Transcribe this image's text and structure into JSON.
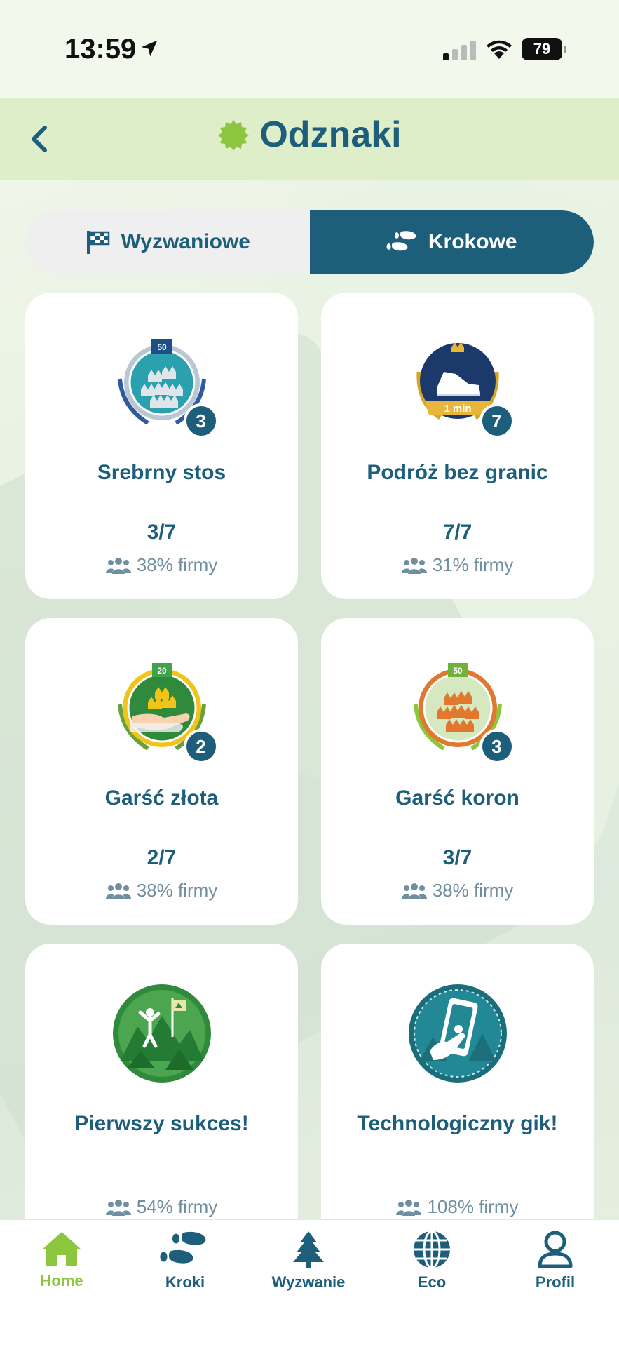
{
  "status": {
    "time": "13:59",
    "battery": "79"
  },
  "header": {
    "title": "Odznaki"
  },
  "segments": {
    "left": "Wyzwaniowe",
    "right": "Krokowe",
    "active": "right"
  },
  "badges": [
    {
      "name": "Srebrny stos",
      "progress": "3/7",
      "percent": "38% firmy",
      "count": "3",
      "ribbon": "50"
    },
    {
      "name": "Podróż bez granic",
      "progress": "7/7",
      "percent": "31% firmy",
      "count": "7",
      "ribbon": "1 min"
    },
    {
      "name": "Garść złota",
      "progress": "2/7",
      "percent": "38% firmy",
      "count": "2",
      "ribbon": "20"
    },
    {
      "name": "Garść koron",
      "progress": "3/7",
      "percent": "38% firmy",
      "count": "3",
      "ribbon": "50"
    },
    {
      "name": "Pierwszy sukces!",
      "progress": "",
      "percent": "54% firmy",
      "count": ""
    },
    {
      "name": "Technologiczny gik!",
      "progress": "",
      "percent": "108% firmy",
      "count": ""
    }
  ],
  "tabs": [
    {
      "label": "Home",
      "icon": "home-icon",
      "active": true
    },
    {
      "label": "Kroki",
      "icon": "footsteps-icon"
    },
    {
      "label": "Wyzwanie",
      "icon": "tree-icon"
    },
    {
      "label": "Eco",
      "icon": "globe-icon"
    },
    {
      "label": "Profil",
      "icon": "user-icon"
    }
  ],
  "colors": {
    "primary": "#1d5f7b",
    "accent": "#8cc63f",
    "header_bg": "#ddeec9"
  }
}
